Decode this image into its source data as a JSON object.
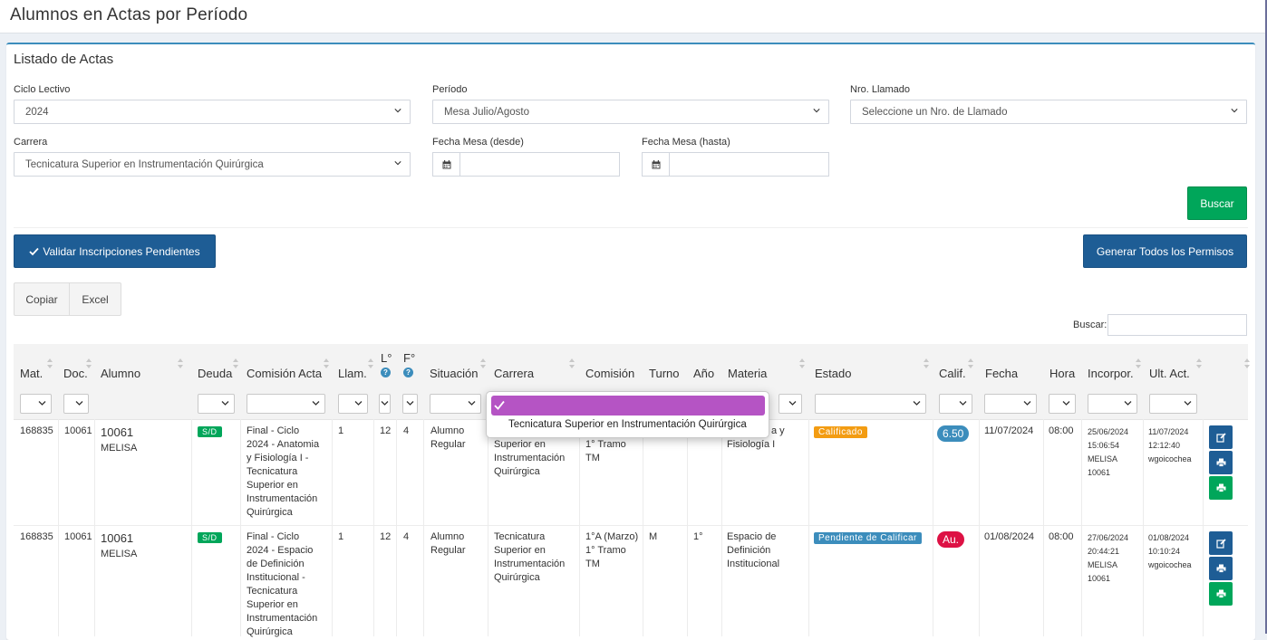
{
  "page": {
    "title": "Alumnos en Actas por Período"
  },
  "box": {
    "title": "Listado de Actas"
  },
  "filters": {
    "ciclo_label": "Ciclo Lectivo",
    "ciclo_value": "2024",
    "periodo_label": "Período",
    "periodo_value": "Mesa Julio/Agosto",
    "llamado_label": "Nro. Llamado",
    "llamado_value": "Seleccione un Nro. de Llamado",
    "carrera_label": "Carrera",
    "carrera_value": "Tecnicatura Superior en Instrumentación Quirúrgica",
    "desde_label": "Fecha Mesa (desde)",
    "hasta_label": "Fecha Mesa (hasta)"
  },
  "buttons": {
    "buscar": "Buscar",
    "validar": "Validar Inscripciones Pendientes",
    "generar": "Generar Todos los Permisos",
    "copiar": "Copiar",
    "excel": "Excel"
  },
  "search": {
    "label": "Buscar:"
  },
  "table": {
    "headers": {
      "mat": "Mat.",
      "doc": "Doc.",
      "alumno": "Alumno",
      "deuda": "Deuda",
      "comision_acta": "Comisión Acta",
      "llam": "Llam.",
      "l": "L°",
      "f": "F°",
      "situacion": "Situación",
      "carrera": "Carrera",
      "comision": "Comisión",
      "turno": "Turno",
      "anio": "Año",
      "materia": "Materia",
      "estado": "Estado",
      "calif": "Calif.",
      "fecha": "Fecha",
      "hora": "Hora",
      "incorpor": "Incorpor.",
      "ult_act": "Ult. Act."
    },
    "rows": [
      {
        "mat": "168835",
        "doc": "10061",
        "alumno_id": "10061",
        "alumno_name": "MELISA",
        "deuda": "S/D",
        "comision_acta": [
          "Final - Ciclo",
          "2024 - Anatomia",
          "y Fisiología I -",
          "Tecnicatura",
          "Superior en",
          "Instrumentación",
          "Quirúrgica"
        ],
        "llam": "1",
        "l": "12",
        "f": "4",
        "situacion": [
          "Alumno",
          "Regular"
        ],
        "carrera": [
          "Superior en",
          "Instrumentación",
          "Quirúrgica"
        ],
        "comision": [
          "1° Tramo",
          "TM"
        ],
        "materia": [
          "a y",
          "Fisiología I"
        ],
        "estado": "Calificado",
        "calif": "6.50",
        "fecha": "11/07/2024",
        "hora": "08:00",
        "incorpor": [
          "25/06/2024",
          "15:06:54",
          "MELISA",
          "10061"
        ],
        "ult_act": [
          "11/07/2024",
          "12:12:40",
          "wgoicochea"
        ]
      },
      {
        "mat": "168835",
        "doc": "10061",
        "alumno_id": "10061",
        "alumno_name": "MELISA",
        "deuda": "S/D",
        "comision_acta": [
          "Final - Ciclo",
          "2024 - Espacio",
          "de Definición",
          "Institucional -",
          "Tecnicatura",
          "Superior en",
          "Instrumentación",
          "Quirúrgica"
        ],
        "llam": "1",
        "l": "12",
        "f": "4",
        "situacion": [
          "Alumno",
          "Regular"
        ],
        "carrera": [
          "Tecnicatura",
          "Superior en",
          "Instrumentación",
          "Quirúrgica"
        ],
        "comision": [
          "1°A (Marzo)",
          "1° Tramo",
          "TM"
        ],
        "turno": "M",
        "anio": "1°",
        "materia": [
          "Espacio de",
          "Definición",
          "Institucional"
        ],
        "estado": "Pendiente de Calificar",
        "calif": "Au.",
        "fecha": "01/08/2024",
        "hora": "08:00",
        "incorpor": [
          "27/06/2024",
          "20:44:21",
          "MELISA",
          "10061"
        ],
        "ult_act": [
          "01/08/2024",
          "10:10:24",
          "wgoicochea"
        ]
      }
    ]
  },
  "dropdown": {
    "selected": "",
    "option": "Tecnicatura Superior en Instrumentación Quirúrgica"
  },
  "colors": {
    "primary": "#1e5d95",
    "success": "#00a65a",
    "warning": "#f39c12",
    "info": "#3c8dbc",
    "danger": "#dd1144",
    "highlight": "#b554c4"
  }
}
